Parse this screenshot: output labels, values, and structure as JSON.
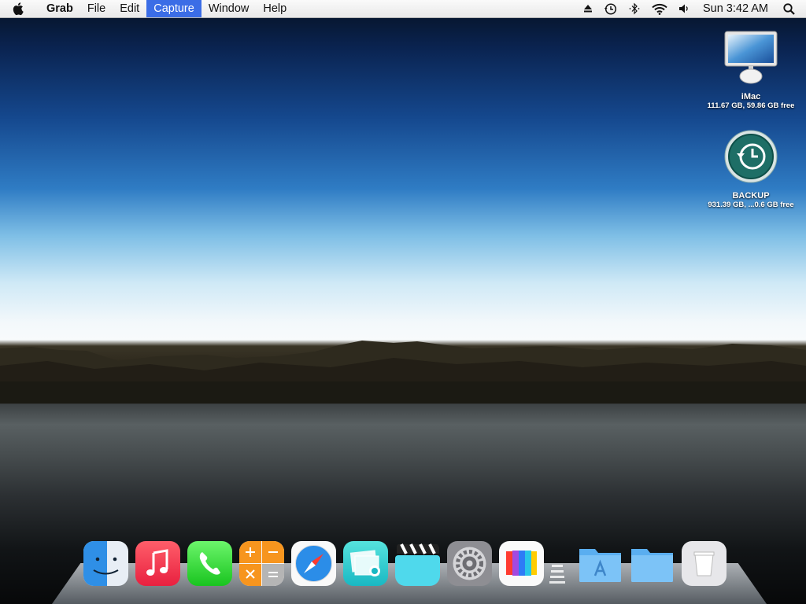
{
  "menubar": {
    "app_name": "Grab",
    "items": [
      "File",
      "Edit",
      "Capture",
      "Window",
      "Help"
    ],
    "active_item": "Capture",
    "clock": "Sun 3:42 AM"
  },
  "desktop_icons": [
    {
      "name": "iMac",
      "subtitle": "111.67 GB, 59.86 GB free",
      "icon": "imac-icon"
    },
    {
      "name": "BACKUP",
      "subtitle": "931.39 GB, ...0.6 GB free",
      "icon": "time-machine-icon"
    }
  ],
  "dock": {
    "apps": [
      "finder-icon",
      "music-icon",
      "phone-icon",
      "calculator-icon",
      "safari-icon",
      "preview-icon",
      "clapper-icon",
      "system-preferences-icon",
      "photo-icon"
    ],
    "folders": [
      "applications-folder-icon",
      "documents-folder-icon",
      "trash-icon"
    ]
  },
  "colors": {
    "menu_highlight": "#3b6de6",
    "sky_top": "#0a2350",
    "sky_mid": "#2f7cc4",
    "horizon": "#f3f8fb"
  }
}
